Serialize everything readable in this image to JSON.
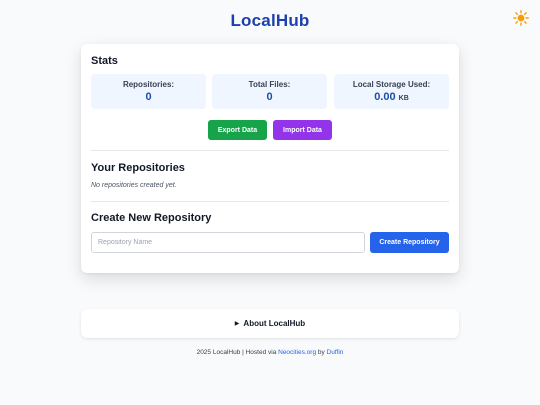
{
  "header": {
    "title": "LocalHub",
    "theme_icon": "sun-icon",
    "theme_icon_color": "#f59e0b"
  },
  "stats": {
    "title": "Stats",
    "items": [
      {
        "label": "Repositories:",
        "value": "0",
        "unit": ""
      },
      {
        "label": "Total Files:",
        "value": "0",
        "unit": ""
      },
      {
        "label": "Local Storage Used:",
        "value": "0.00",
        "unit": "KB"
      }
    ],
    "export_label": "Export Data",
    "import_label": "Import Data"
  },
  "repositories": {
    "title": "Your Repositories",
    "empty_message": "No repositories created yet."
  },
  "create": {
    "title": "Create New Repository",
    "input_placeholder": "Repository Name",
    "input_value": "",
    "button_label": "Create Repository"
  },
  "about": {
    "label": "About LocalHub",
    "arrow": "▶"
  },
  "footer": {
    "prefix": "2025 LocalHub | Hosted via ",
    "host_link": "Neocities.org",
    "by_text": " by ",
    "author_link": "Duffin"
  },
  "colors": {
    "accent": "#1e40af",
    "export": "#16a34a",
    "import": "#9333ea",
    "create": "#2563eb",
    "stat_bg": "#eff6ff"
  }
}
